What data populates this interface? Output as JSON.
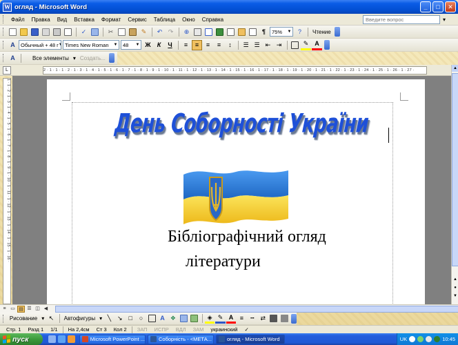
{
  "window": {
    "title": "огляд - Microsoft Word",
    "minimize": "_",
    "maximize": "□",
    "close": "✕"
  },
  "menu": {
    "items": [
      "Файл",
      "Правка",
      "Вид",
      "Вставка",
      "Формат",
      "Сервис",
      "Таблица",
      "Окно",
      "Справка"
    ],
    "help_placeholder": "Введите вопрос"
  },
  "standard_toolbar": {
    "zoom": "75%",
    "read_button": "Чтение"
  },
  "formatting_toolbar": {
    "style": "Обычный + 48 г",
    "font": "Times New Roman",
    "size": "48",
    "bold": "Ж",
    "italic": "К",
    "underline": "Ч"
  },
  "styles_toolbar": {
    "all_elements": "Все элементы",
    "create": "Создать..."
  },
  "rulers": {
    "horizontal": "2 · 1 · 1 · 1 · 2 · 1 · 3 · 1 · 4 · 1 · 5 · 1 · 6 · 1 · 7 · 1 · 8 · 1 · 9 · 1 · 10 · 1 · 11 · 1 · 12 · 1 · 13 · 1 · 14 · 1 · 15 · 1 · 16 · 1 · 17 · 1 · 18 · 1 · 19 · 1 · 20 · 1 · 21 · 1 · 22 · 1 · 23 · 1 · 24 · 1 · 25 · 1 · 26 · 1 · 27 ·",
    "vertical": "1 · 1 · 2 · 1 · 3 · 1 · 4 · 1 · 5 · 1 · 6 · 1 · 7 · 1 · 8 · 1 · 9 · 1 · 10 · 1 · 11 · 1 · 12 · 1 · 13 · 1 · 14 · 1 · 15 · 1 · 16 ·"
  },
  "document": {
    "wordart_title": "День Соборності України",
    "line1": "Бібліографічний огляд",
    "line2": "літератури"
  },
  "drawing_toolbar": {
    "drawing": "Рисование",
    "autoshapes": "Автофигуры"
  },
  "status_bar": {
    "page": "Стр. 1",
    "section": "Разд 1",
    "pages": "1/1",
    "at": "На 2,4см",
    "line": "Ст 3",
    "col": "Кол 2",
    "rec": "ЗАП",
    "trk": "ИСПР",
    "ext": "ВДЛ",
    "ovr": "ЗАМ",
    "language": "украинский"
  },
  "taskbar": {
    "start": "пуск",
    "tasks": [
      {
        "label": "Microsoft PowerPoint ...",
        "icon_color": "#D24726",
        "active": false
      },
      {
        "label": "Соборність - <МЕТА...",
        "icon_color": "#2B579A",
        "active": false
      },
      {
        "label": "огляд - Microsoft Word",
        "icon_color": "#2B579A",
        "active": true
      }
    ],
    "tray_lang": "UK",
    "clock": "10:45"
  },
  "colors": {
    "wordart": "#1E50D8",
    "flag_blue": "#2A7BD5",
    "flag_yellow": "#F6D22E",
    "trident": "#D4A017"
  }
}
